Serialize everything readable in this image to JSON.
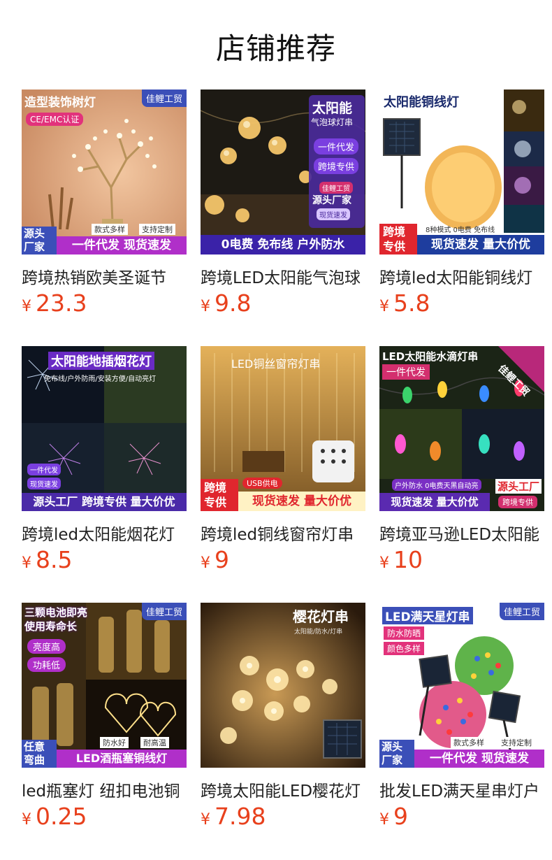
{
  "section_title": "店铺推荐",
  "currency_symbol": "¥",
  "products": [
    {
      "name": "跨境热销欧美圣诞节",
      "price": "23.3",
      "image_text": {
        "headline": "造型装饰树灯",
        "badge": "CE/EMC认证",
        "brand": "佳鲤工贸",
        "tags": [
          "款式多样",
          "支持定制"
        ],
        "corner": "源头厂家",
        "bottom": "一件代发 现货速发"
      }
    },
    {
      "name": "跨境LED太阳能气泡球",
      "price": "9.8",
      "image_text": {
        "headline": "太阳能",
        "subheadline": "气泡球灯串",
        "tags": [
          "一件代发",
          "跨境专供"
        ],
        "brand": "佳鲤工贸",
        "source": "源头厂家",
        "ship": "现货速发",
        "bottom": "0电费 免布线 户外防水"
      }
    },
    {
      "name": "跨境led太阳能铜线灯",
      "price": "5.8",
      "image_text": {
        "headline": "太阳能铜线灯",
        "corner": "跨境专供",
        "small": "8种模式 0电费 免布线",
        "bottom": "现货速发 量大价优"
      }
    },
    {
      "name": "跨境led太阳能烟花灯",
      "price": "8.5",
      "image_text": {
        "headline": "太阳能地插烟花灯",
        "subheadline": "免布线/户外防雨/安装方便/自动亮灯",
        "tags": [
          "一件代发",
          "现货速发"
        ],
        "bottom": "源头工厂 跨境专供 量大价优"
      }
    },
    {
      "name": "跨境led铜线窗帘灯串",
      "price": "9",
      "image_text": {
        "headline": "LED铜丝窗帘灯串",
        "corner": "跨境专供",
        "small": "USB供电",
        "bottom": "现货速发 量大价优"
      }
    },
    {
      "name": "跨境亚马逊LED太阳能",
      "price": "10",
      "image_text": {
        "headline": "LED太阳能水滴灯串",
        "tag": "一件代发",
        "brand": "佳鲤工贸",
        "small": "户外防水 0电费天黑自动亮",
        "source": "源头工厂",
        "ship": "跨境专供",
        "bottom": "现货速发 量大价优"
      }
    },
    {
      "name": "led瓶塞灯 纽扣电池铜",
      "price": "0.25",
      "image_text": {
        "headline": "三颗电池即亮 使用寿命长",
        "brand": "佳鲤工贸",
        "tags": [
          "亮度高",
          "功耗低"
        ],
        "features": [
          "防水好",
          "耐高温"
        ],
        "corner": "任意弯曲",
        "bottom": "LED酒瓶塞铜线灯"
      }
    },
    {
      "name": "跨境太阳能LED樱花灯",
      "price": "7.98",
      "image_text": {
        "headline": "樱花灯串",
        "subheadline": "太阳能/防水/灯串"
      }
    },
    {
      "name": "批发LED满天星串灯户",
      "price": "9",
      "image_text": {
        "headline": "LED满天星灯串",
        "brand": "佳鲤工贸",
        "tags": [
          "防水防晒",
          "颜色多样"
        ],
        "features": [
          "款式多样",
          "支持定制"
        ],
        "corner": "源头厂家",
        "bottom": "一件代发 现货速发"
      }
    }
  ]
}
